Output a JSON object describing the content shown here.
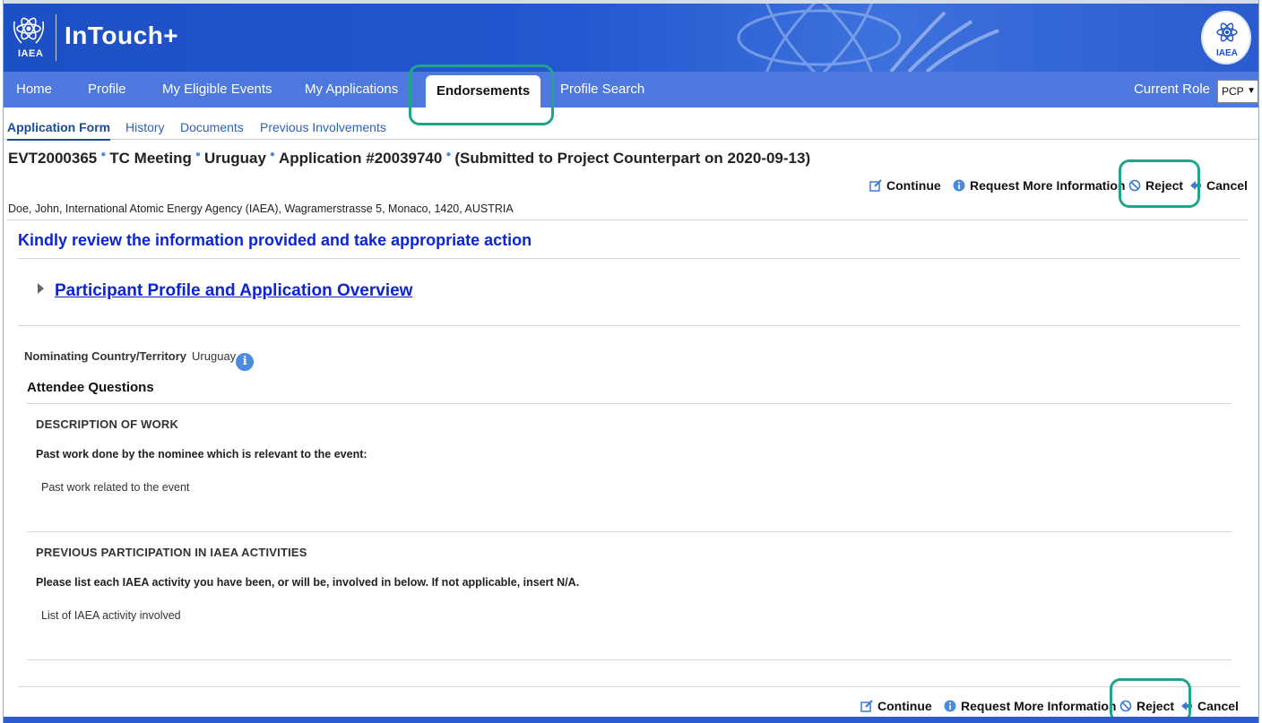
{
  "header": {
    "logo_text": "IAEA",
    "app_title": "InTouch+"
  },
  "nav": {
    "items": [
      {
        "label": "Home"
      },
      {
        "label": "Profile"
      },
      {
        "label": "My Eligible Events"
      },
      {
        "label": "My Applications"
      },
      {
        "label": "Endorsements",
        "active": true
      },
      {
        "label": "Profile Search"
      }
    ],
    "current_role_label": "Current Role",
    "current_role_value": "PCP"
  },
  "subtabs": [
    {
      "label": "Application Form",
      "active": true
    },
    {
      "label": "History"
    },
    {
      "label": "Documents"
    },
    {
      "label": "Previous Involvements"
    }
  ],
  "title": {
    "event_id": "EVT2000365",
    "event_type": "TC Meeting",
    "country": "Uruguay",
    "application": "Application #20039740",
    "status": "(Submitted to Project Counterpart on 2020-09-13)"
  },
  "actions": {
    "continue": "Continue",
    "request_more_info": "Request More Information",
    "reject": "Reject",
    "cancel": "Cancel"
  },
  "applicant_address": "Doe, John, International Atomic Energy Agency (IAEA), Wagramerstrasse 5, Monaco, 1420, AUSTRIA",
  "review_message": "Kindly review the information provided and take appropriate action",
  "overview_link": "Participant Profile and Application Overview",
  "nominating": {
    "label": "Nominating Country/Territory",
    "value": "Uruguay",
    "info_icon": "i"
  },
  "attendee_questions": {
    "heading": "Attendee Questions",
    "sections": [
      {
        "title": "DESCRIPTION OF WORK",
        "question": "Past work done by the nominee which is relevant to the event:",
        "answer": "Past work related to the event"
      },
      {
        "title": "PREVIOUS PARTICIPATION IN IAEA ACTIVITIES",
        "question": "Please list each IAEA activity you have been, or will be, involved in below. If not applicable, insert N/A.",
        "answer": "List of IAEA activity involved"
      }
    ]
  },
  "colors": {
    "header_blue": "#1d4fc4",
    "nav_blue": "#4d79de",
    "link_blue": "#0a24d6",
    "highlight_green": "#1ea58a"
  }
}
